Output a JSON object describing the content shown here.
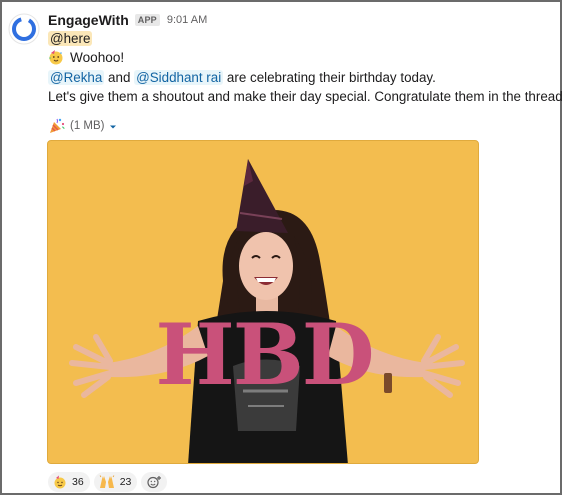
{
  "message": {
    "sender": "EngageWith",
    "app_badge": "APP",
    "time": "9:01 AM",
    "here_mention": "@here",
    "headline": "Woohoo!",
    "mention_1": "@Rekha",
    "and_text": "and",
    "mention_2": "@Siddhant rai",
    "celebrating_text": "are celebrating their birthday today.",
    "shoutout_text": "Let's give them a shoutout and make their day special. Congratulate them in the thread"
  },
  "attachment": {
    "size": "(1 MB)",
    "icon": "party-popper-icon",
    "gif_text": "HBD"
  },
  "reactions": [
    {
      "icon": "birthday-face-icon",
      "count": "36"
    },
    {
      "icon": "raised-hands-icon",
      "count": "23"
    }
  ],
  "colors": {
    "gif_background": "#f3bd4f",
    "hbd_text": "#c9517a",
    "mention_link": "#1264a3",
    "here_highlight": "#fbe7b8"
  }
}
